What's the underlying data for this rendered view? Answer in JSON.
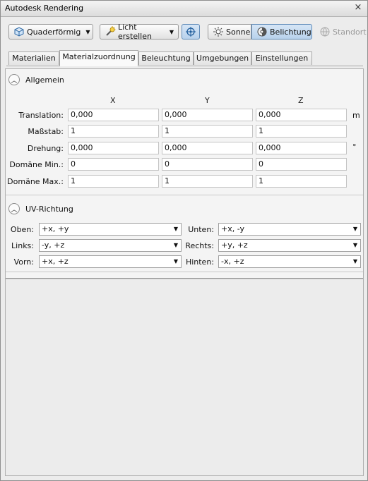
{
  "window": {
    "title": "Autodesk Rendering",
    "close_glyph": "×"
  },
  "toolbar": {
    "mapping_button": {
      "label": "Quaderförmig",
      "icon": "box-mapping-icon"
    },
    "create_light_button": {
      "label": "Licht erstellen",
      "icon": "light-icon"
    },
    "target_icon": "crosshair-target-icon",
    "sun_button": {
      "label": "Sonne",
      "icon": "sun-icon"
    },
    "exposure_button": {
      "label": "Belichtung",
      "icon": "exposure-icon"
    },
    "location_button": {
      "label": "Standort",
      "icon": "globe-icon"
    }
  },
  "tabs": [
    "Materialien",
    "Materialzuordnung",
    "Beleuchtung",
    "Umgebungen",
    "Einstellungen"
  ],
  "active_tab": "Materialzuordnung",
  "general": {
    "title": "Allgemein",
    "axes": [
      "X",
      "Y",
      "Z"
    ],
    "rows": [
      {
        "label": "Translation:",
        "values": [
          "0,000",
          "0,000",
          "0,000"
        ],
        "unit": "m"
      },
      {
        "label": "Maßstab:",
        "values": [
          "1",
          "1",
          "1"
        ],
        "unit": ""
      },
      {
        "label": "Drehung:",
        "values": [
          "0,000",
          "0,000",
          "0,000"
        ],
        "unit": "°"
      },
      {
        "label": "Domäne Min.:",
        "values": [
          "0",
          "0",
          "0"
        ],
        "unit": ""
      },
      {
        "label": "Domäne Max.:",
        "values": [
          "1",
          "1",
          "1"
        ],
        "unit": ""
      }
    ]
  },
  "uv": {
    "title": "UV-Richtung",
    "rows": [
      {
        "left_label": "Oben:",
        "left_value": "+x, +y",
        "right_label": "Unten:",
        "right_value": "+x, -y"
      },
      {
        "left_label": "Links:",
        "left_value": "-y, +z",
        "right_label": "Rechts:",
        "right_value": "+y, +z"
      },
      {
        "left_label": "Vorn:",
        "left_value": "+x, +z",
        "right_label": "Hinten:",
        "right_value": "-x, +z"
      }
    ]
  }
}
